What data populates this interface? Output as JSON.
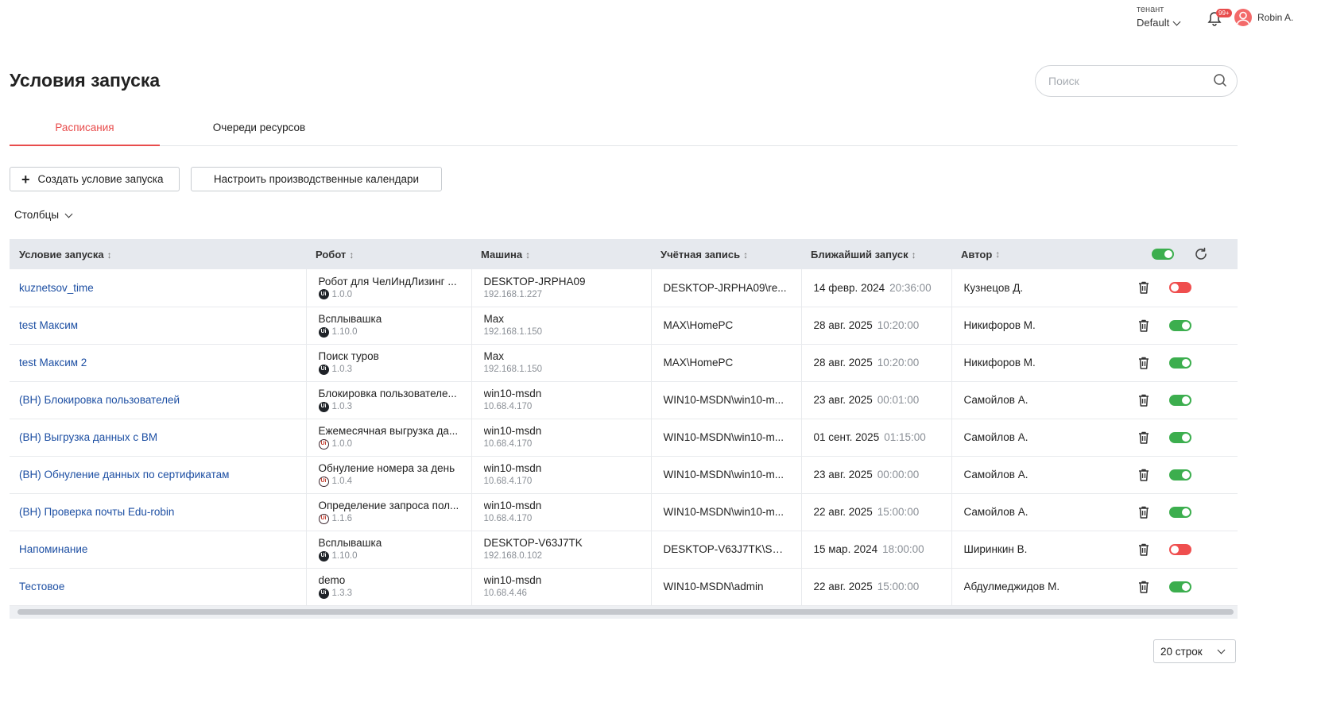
{
  "header": {
    "tenant_label": "тенант",
    "tenant_value": "Default",
    "notifications_badge": "99+",
    "user_name": "Robin A."
  },
  "page": {
    "title": "Условия запуска",
    "search_placeholder": "Поиск"
  },
  "tabs": [
    {
      "label": "Расписания",
      "active": true
    },
    {
      "label": "Очереди ресурсов",
      "active": false
    }
  ],
  "toolbar": {
    "create_label": "Создать условие запуска",
    "calendars_label": "Настроить производственные календари",
    "columns_label": "Столбцы"
  },
  "table": {
    "headers": [
      "Условие запуска",
      "Робот",
      "Машина",
      "Учётная запись",
      "Ближайший запуск",
      "Автор"
    ],
    "header_toggle_on": true,
    "rows": [
      {
        "name": "kuznetsov_time",
        "robot": "Робот для ЧелИндЛизинг ...",
        "robot_version": "1.0.0",
        "robot_badge": "solid",
        "machine": "DESKTOP-JRPHA09",
        "ip": "192.168.1.227",
        "account": "DESKTOP-JRPHA09\\re...",
        "date": "14 февр. 2024",
        "time": "20:36:00",
        "author": "Кузнецов Д.",
        "enabled": false
      },
      {
        "name": "test Максим",
        "robot": "Всплывашка",
        "robot_version": "1.10.0",
        "robot_badge": "solid",
        "machine": "Max",
        "ip": "192.168.1.150",
        "account": "MAX\\HomePC",
        "date": "28 авг. 2025",
        "time": "10:20:00",
        "author": "Никифоров М.",
        "enabled": true
      },
      {
        "name": "test Максим 2",
        "robot": "Поиск туров",
        "robot_version": "1.0.3",
        "robot_badge": "solid",
        "machine": "Max",
        "ip": "192.168.1.150",
        "account": "MAX\\HomePC",
        "date": "28 авг. 2025",
        "time": "10:20:00",
        "author": "Никифоров М.",
        "enabled": true
      },
      {
        "name": "(ВН) Блокировка пользователей",
        "robot": "Блокировка пользователе...",
        "robot_version": "1.0.3",
        "robot_badge": "solid",
        "machine": "win10-msdn",
        "ip": "10.68.4.170",
        "account": "WIN10-MSDN\\win10-m...",
        "date": "23 авг. 2025",
        "time": "00:01:00",
        "author": "Самойлов А.",
        "enabled": true
      },
      {
        "name": "(ВН) Выгрузка данных с ВМ",
        "robot": "Ежемесячная выгрузка да...",
        "robot_version": "1.0.0",
        "robot_badge": "outline",
        "machine": "win10-msdn",
        "ip": "10.68.4.170",
        "account": "WIN10-MSDN\\win10-m...",
        "date": "01 сент. 2025",
        "time": "01:15:00",
        "author": "Самойлов А.",
        "enabled": true
      },
      {
        "name": "(ВН) Обнуление данных по сертификатам",
        "robot": "Обнуление номера за день",
        "robot_version": "1.0.4",
        "robot_badge": "outline",
        "machine": "win10-msdn",
        "ip": "10.68.4.170",
        "account": "WIN10-MSDN\\win10-m...",
        "date": "23 авг. 2025",
        "time": "00:00:00",
        "author": "Самойлов А.",
        "enabled": true
      },
      {
        "name": "(ВН) Проверка почты Edu-robin",
        "robot": "Определение запроса пол...",
        "robot_version": "1.1.6",
        "robot_badge": "outline",
        "machine": "win10-msdn",
        "ip": "10.68.4.170",
        "account": "WIN10-MSDN\\win10-m...",
        "date": "22 авг. 2025",
        "time": "15:00:00",
        "author": "Самойлов А.",
        "enabled": true
      },
      {
        "name": "Напоминание",
        "robot": "Всплывашка",
        "robot_version": "1.10.0",
        "robot_badge": "solid",
        "machine": "DESKTOP-V63J7TK",
        "ip": "192.168.0.102",
        "account": "DESKTOP-V63J7TK\\Shi...",
        "date": "15 мар. 2024",
        "time": "18:00:00",
        "author": "Ширинкин В.",
        "enabled": false
      },
      {
        "name": "Тестовое",
        "robot": "demo",
        "robot_version": "1.3.3",
        "robot_badge": "solid",
        "machine": "win10-msdn",
        "ip": "10.68.4.46",
        "account": "WIN10-MSDN\\admin",
        "date": "22 авг. 2025",
        "time": "15:00:00",
        "author": "Абдулмеджидов М.",
        "enabled": true
      }
    ]
  },
  "pagination": {
    "rows_per_page": "20 строк"
  },
  "colors": {
    "accent": "#e84c4c",
    "link": "#1d4fa3",
    "toggle_on": "#3cae4e",
    "toggle_off": "#ef4e4e",
    "header_bg": "#e6e9ee"
  }
}
